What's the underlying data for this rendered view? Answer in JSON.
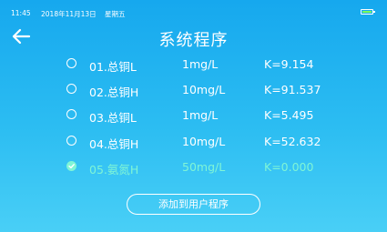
{
  "status_bar": {
    "time": "11:45",
    "date": "2018年11月13日",
    "weekday": "星期五",
    "battery_color": "#7CFC5A"
  },
  "header": {
    "back_icon": "arrow-left-icon",
    "title": "系统程序"
  },
  "programs": [
    {
      "name": "01.总铜L",
      "concentration": "1mg/L",
      "k": "K=9.154",
      "selected": false
    },
    {
      "name": "02.总铜H",
      "concentration": "10mg/L",
      "k": "K=91.537",
      "selected": false
    },
    {
      "name": "03.总铜L",
      "concentration": "1mg/L",
      "k": "K=5.495",
      "selected": false
    },
    {
      "name": "04.总铜H",
      "concentration": "10mg/L",
      "k": "K=52.632",
      "selected": false
    },
    {
      "name": "05.氨氮H",
      "concentration": "50mg/L",
      "k": "K=0.000",
      "selected": true
    }
  ],
  "actions": {
    "add_to_user_label": "添加到用户程序"
  },
  "colors": {
    "selected": "#7FF5D6",
    "background_top": "#16A8EE",
    "background_bottom": "#49CFF6"
  }
}
